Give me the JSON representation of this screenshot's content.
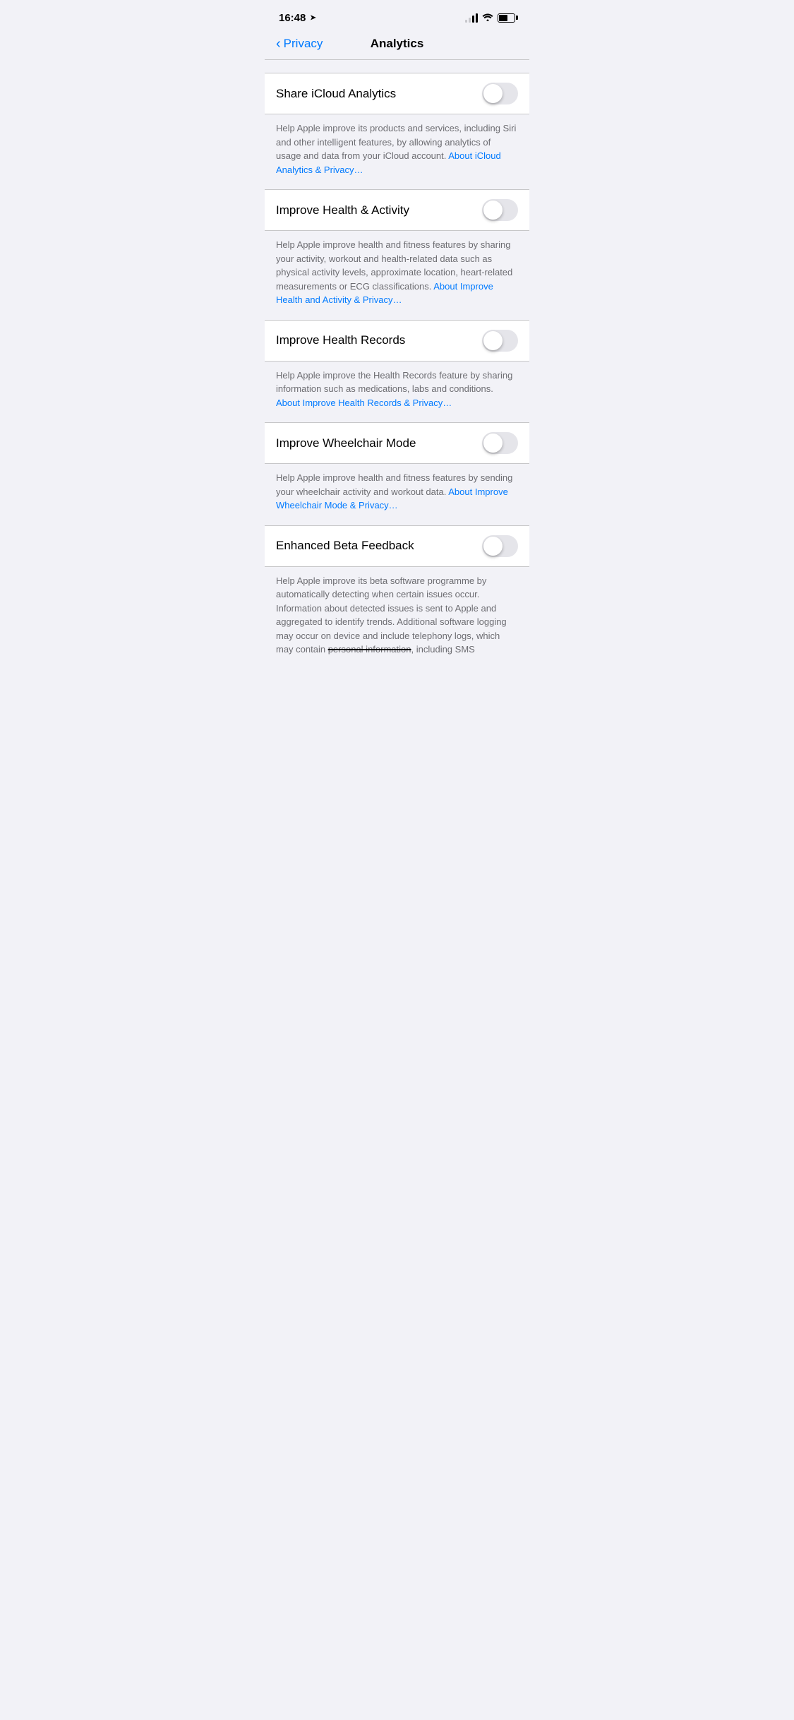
{
  "statusBar": {
    "time": "16:48",
    "hasLocationArrow": true
  },
  "navBar": {
    "backLabel": "Privacy",
    "title": "Analytics"
  },
  "settings": [
    {
      "id": "share-icloud-analytics",
      "label": "Share iCloud Analytics",
      "toggled": false,
      "description": "Help Apple improve its products and services, including Siri and other intelligent features, by allowing analytics of usage and data from your iCloud account. ",
      "linkText": "About iCloud Analytics & Privacy…"
    },
    {
      "id": "improve-health-activity",
      "label": "Improve Health & Activity",
      "toggled": false,
      "description": "Help Apple improve health and fitness features by sharing your activity, workout and health-related data such as physical activity levels, approximate location, heart-related measurements or ECG classifications. ",
      "linkText": "About Improve Health and Activity & Privacy…"
    },
    {
      "id": "improve-health-records",
      "label": "Improve Health Records",
      "toggled": false,
      "description": "Help Apple improve the Health Records feature by sharing information such as medications, labs and conditions. ",
      "linkText": "About Improve Health Records & Privacy…"
    },
    {
      "id": "improve-wheelchair-mode",
      "label": "Improve Wheelchair Mode",
      "toggled": false,
      "description": "Help Apple improve health and fitness features by sending your wheelchair activity and workout data. ",
      "linkText": "About Improve Wheelchair Mode & Privacy…"
    },
    {
      "id": "enhanced-beta-feedback",
      "label": "Enhanced Beta Feedback",
      "toggled": false,
      "description": "Help Apple improve its beta software programme by automatically detecting when certain issues occur. Information about detected issues is sent to Apple and aggregated to identify trends. Additional software logging may occur on device and include telephony logs, which may contain ",
      "redactedText": "personal information",
      "descriptionSuffix": ", including SMS"
    }
  ]
}
